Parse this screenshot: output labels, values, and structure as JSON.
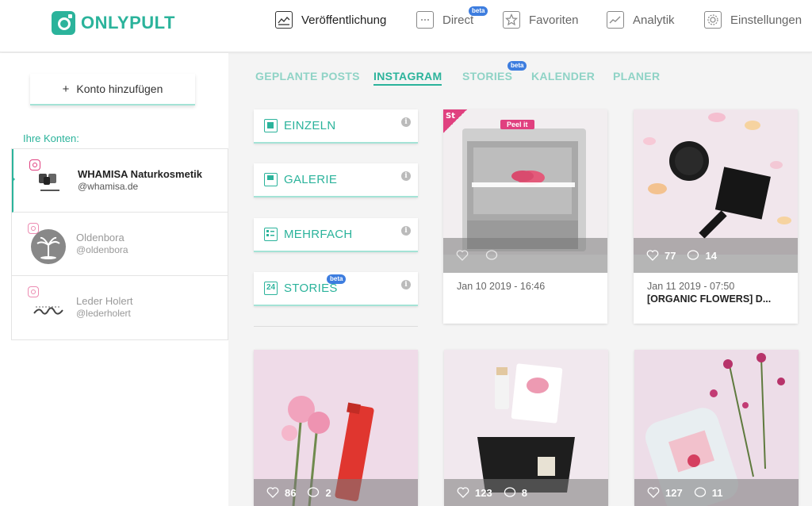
{
  "brand": {
    "name": "ONLYPULT",
    "color": "#2bb39b"
  },
  "nav": [
    {
      "label": "Veröffentlichung",
      "icon": "publish-icon",
      "active": true
    },
    {
      "label": "Direct",
      "icon": "chat-icon",
      "badge": "beta"
    },
    {
      "label": "Favoriten",
      "icon": "star-icon"
    },
    {
      "label": "Analytik",
      "icon": "chart-icon"
    },
    {
      "label": "Einstellungen",
      "icon": "gear-icon"
    }
  ],
  "sidebar": {
    "add_account_label": "Konto hinzufügen",
    "accounts_label": "Ihre Konten:",
    "accounts": [
      {
        "name": "WHAMISA Naturkosmetik",
        "handle": "@whamisa.de",
        "active": true
      },
      {
        "name": "Oldenbora",
        "handle": "@oldenbora"
      },
      {
        "name": "Leder Holert",
        "handle": "@lederholert"
      }
    ]
  },
  "tabs": [
    {
      "label": "GEPLANTE POSTS"
    },
    {
      "label": "INSTAGRAM",
      "active": true
    },
    {
      "label": "STORIES",
      "badge": "beta"
    },
    {
      "label": "KALENDER"
    },
    {
      "label": "PLANER"
    }
  ],
  "post_types": [
    {
      "label": "EINZELN",
      "icon": "single-post-icon"
    },
    {
      "label": "GALERIE",
      "icon": "gallery-icon"
    },
    {
      "label": "MEHRFACH",
      "icon": "multi-post-icon"
    },
    {
      "label": "STORIES",
      "icon": "stories-24-icon",
      "icon_text": "24",
      "badge": "beta"
    }
  ],
  "posts": [
    {
      "date": "Jan 10 2019 - 16:46",
      "caption": "",
      "likes": "",
      "comments": "",
      "story_badge": "St",
      "story_sticker": "Peel it"
    },
    {
      "date": "Jan 11 2019 - 07:50",
      "caption": "[ORGANIC FLOWERS] D...",
      "likes": "77",
      "comments": "14"
    },
    {
      "date": "",
      "caption": "",
      "likes": "86",
      "comments": "2"
    },
    {
      "date": "",
      "caption": "",
      "likes": "123",
      "comments": "8"
    },
    {
      "date": "",
      "caption": "",
      "likes": "127",
      "comments": "11"
    }
  ],
  "icons": {
    "plus": "+",
    "info": "i"
  },
  "colors": {
    "accent": "#2bb39b",
    "beta_badge": "#3d7ddf",
    "instagram": "#e0407f"
  }
}
